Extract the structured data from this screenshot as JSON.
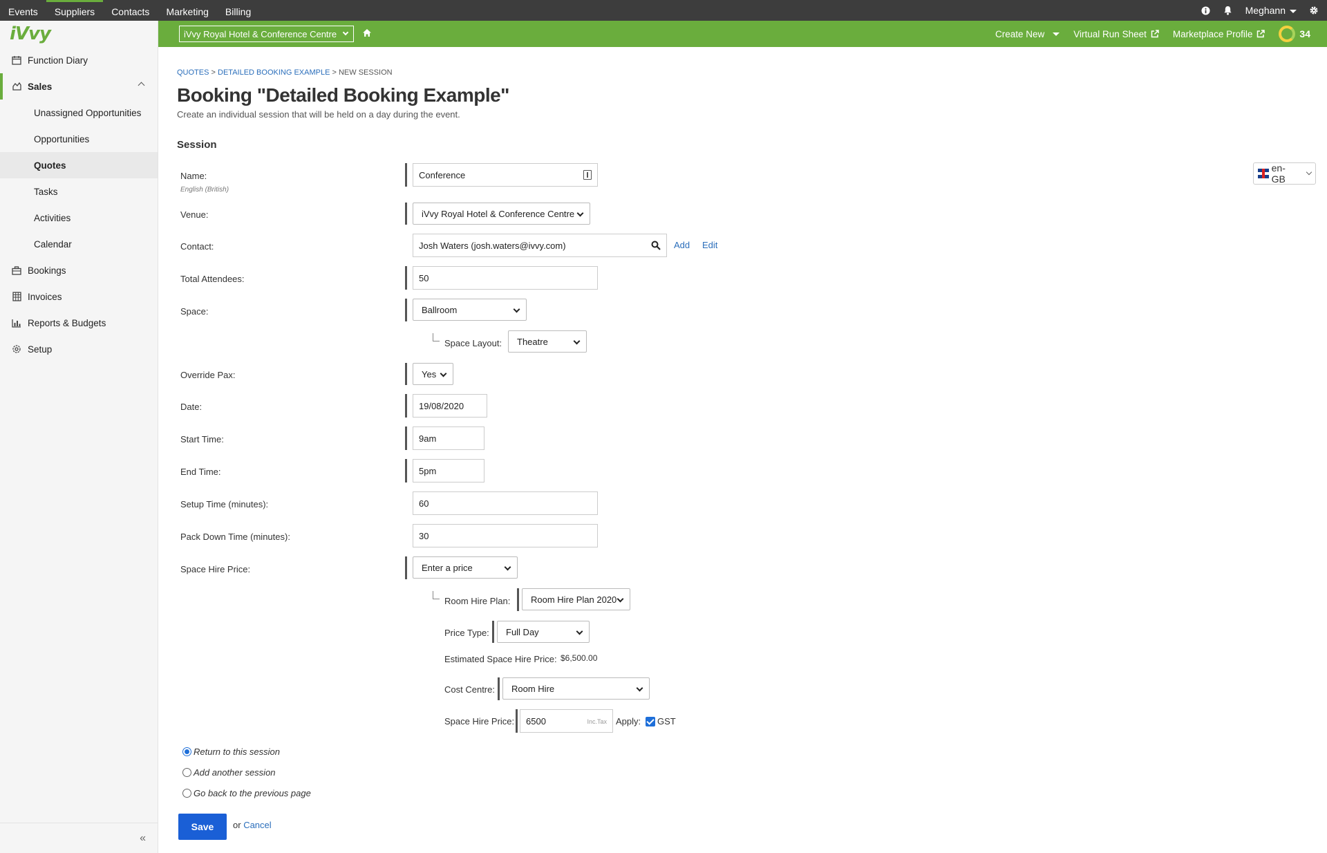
{
  "topnav": {
    "items": [
      {
        "label": "Events"
      },
      {
        "label": "Suppliers"
      },
      {
        "label": "Contacts"
      },
      {
        "label": "Marketing"
      },
      {
        "label": "Billing"
      }
    ],
    "user": "Meghann"
  },
  "sidebar": {
    "logo": "iVvy",
    "items": [
      {
        "label": "Function Diary",
        "icon": "calendar-icon"
      },
      {
        "label": "Sales",
        "icon": "sales-icon"
      },
      {
        "label": "Unassigned Opportunities"
      },
      {
        "label": "Opportunities"
      },
      {
        "label": "Quotes"
      },
      {
        "label": "Tasks"
      },
      {
        "label": "Activities"
      },
      {
        "label": "Calendar"
      },
      {
        "label": "Bookings",
        "icon": "briefcase-icon"
      },
      {
        "label": "Invoices",
        "icon": "invoice-icon"
      },
      {
        "label": "Reports & Budgets",
        "icon": "chart-icon"
      },
      {
        "label": "Setup",
        "icon": "gear-icon"
      }
    ],
    "collapse": "«"
  },
  "greenbar": {
    "venue": "iVvy Royal Hotel & Conference Centre",
    "create_new": "Create New",
    "virtual_run_sheet": "Virtual Run Sheet",
    "marketplace_profile": "Marketplace Profile",
    "count": "34"
  },
  "breadcrumb": {
    "items": [
      "QUOTES",
      "DETAILED BOOKING EXAMPLE",
      "NEW SESSION"
    ],
    "sep": ">"
  },
  "page": {
    "title": "Booking \"Detailed Booking Example\"",
    "subtitle": "Create an individual session that will be held on a day during the event.",
    "section": "Session",
    "lang": "en-GB"
  },
  "form": {
    "name": {
      "label": "Name:",
      "sublabel": "English (British)",
      "value": "Conference"
    },
    "venue": {
      "label": "Venue:",
      "value": "iVvy Royal Hotel & Conference Centre"
    },
    "contact": {
      "label": "Contact:",
      "value": "Josh Waters (josh.waters@ivvy.com)",
      "add": "Add",
      "edit": "Edit"
    },
    "attendees": {
      "label": "Total Attendees:",
      "value": "50"
    },
    "space": {
      "label": "Space:",
      "value": "Ballroom"
    },
    "space_layout": {
      "label": "Space Layout:",
      "value": "Theatre"
    },
    "override_pax": {
      "label": "Override Pax:",
      "value": "Yes"
    },
    "date": {
      "label": "Date:",
      "value": "19/08/2020"
    },
    "start_time": {
      "label": "Start Time:",
      "value": "9am"
    },
    "end_time": {
      "label": "End Time:",
      "value": "5pm"
    },
    "setup_time": {
      "label": "Setup Time (minutes):",
      "value": "60"
    },
    "pack_down": {
      "label": "Pack Down Time (minutes):",
      "value": "30"
    },
    "space_hire_price_mode": {
      "label": "Space Hire Price:",
      "value": "Enter a price"
    },
    "room_hire_plan": {
      "label": "Room Hire Plan:",
      "value": "Room Hire Plan 2020"
    },
    "price_type": {
      "label": "Price Type:",
      "value": "Full Day"
    },
    "estimated": {
      "label": "Estimated Space Hire Price:",
      "value": "$6,500.00"
    },
    "cost_centre": {
      "label": "Cost Centre:",
      "value": "Room Hire"
    },
    "space_hire_price": {
      "label": "Space Hire Price:",
      "value": "6500",
      "suffix": "Inc.Tax",
      "apply": "Apply:",
      "gst": "GST"
    }
  },
  "after_save": {
    "options": [
      "Return to this session",
      "Add another session",
      "Go back to the previous page"
    ],
    "selected": 0
  },
  "actions": {
    "save": "Save",
    "or": "or",
    "cancel": "Cancel"
  },
  "colors": {
    "brand_green": "#6aad3d",
    "topbar": "#3d3d3d",
    "primary_blue": "#1a5fd6",
    "link_blue": "#2a6ebb"
  }
}
